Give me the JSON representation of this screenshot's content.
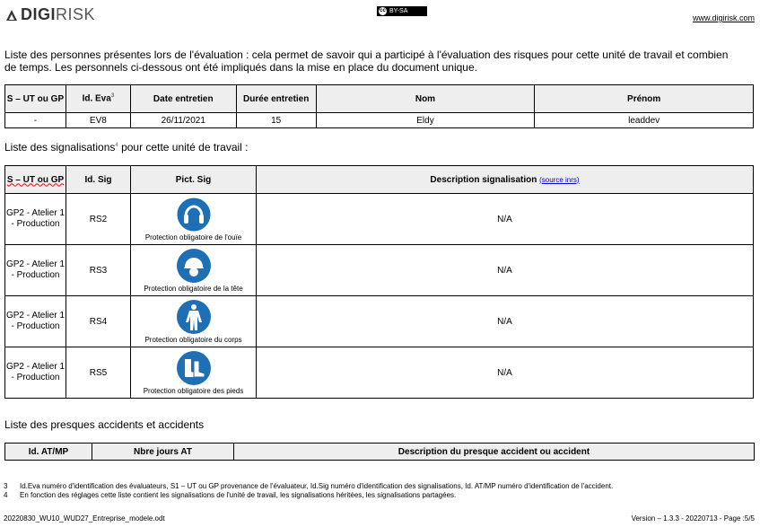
{
  "header": {
    "logo_bold": "DIGI",
    "logo_light": "RISK",
    "license": "BY-SA",
    "website": "www.digirisk.com"
  },
  "intro_text": "Liste des personnes présentes lors de l'évaluation : cela permet de savoir qui a participé à l'évaluation des risques pour cette unité de travail et combien de temps. Les personnels ci-dessous ont été impliqués dans la mise en place du document unique.",
  "persons_table": {
    "headers": [
      "S – UT ou GP",
      "Id. Eva",
      "Date entretien",
      "Durée entretien",
      "Nom",
      "Prénom"
    ],
    "id_eva_sup": "3",
    "rows": [
      [
        "-",
        "EV8",
        "26/11/2021",
        "15",
        "Eldy",
        "leaddev"
      ]
    ]
  },
  "signals_text": "Liste des signalisations",
  "signals_sup": "4",
  "signals_text_after": " pour cette unité de travail :",
  "signals_table": {
    "headers": [
      "S – UT ou GP",
      "Id. Sig",
      "Pict. Sig",
      "Description signalisation"
    ],
    "source_link": "(source inrs)",
    "rows": [
      {
        "ut": "GP2 - Atelier 1 - Production",
        "id": "RS2",
        "icon": "ear-protection-icon",
        "label": "Protection obligatoire de l'ouïe",
        "desc": "N/A"
      },
      {
        "ut": "GP2 - Atelier 1 - Production",
        "id": "RS3",
        "icon": "head-protection-icon",
        "label": "Protection obligatoire de la tête",
        "desc": "N/A"
      },
      {
        "ut": "GP2 - Atelier 1 - Production",
        "id": "RS4",
        "icon": "body-protection-icon",
        "label": "Protection obligatoire du corps",
        "desc": "N/A"
      },
      {
        "ut": "GP2 - Atelier 1 - Production",
        "id": "RS5",
        "icon": "foot-protection-icon",
        "label": "Protection obligatoire des pieds",
        "desc": "N/A"
      }
    ]
  },
  "accidents_text": "Liste des presques accidents et accidents",
  "accidents_table": {
    "headers": [
      "Id. AT/MP",
      "Nbre jours AT",
      "Description du presque accident ou accident"
    ]
  },
  "footnotes": [
    {
      "n": "3",
      "text": "Id.Eva numéro d'identification des évaluateurs, S1 – UT ou GP provenance de l'évaluateur, Id.Sig numéro d'identification des signalisations, Id. AT/MP numéro d'identification de l'accident."
    },
    {
      "n": "4",
      "text": "En fonction des réglages cette liste contient les signalisations de l'unité de travail, les signalisations héritées, les signalisations partagées."
    }
  ],
  "footer": {
    "filename": "20220830_WU10_WUD27_Entreprise_modele.odt",
    "version": "Version – 1.3.3 - 20220713 - Page :5/5"
  },
  "colors": {
    "sign_blue": "#1f6fb5",
    "header_bg": "#eeeeee"
  }
}
